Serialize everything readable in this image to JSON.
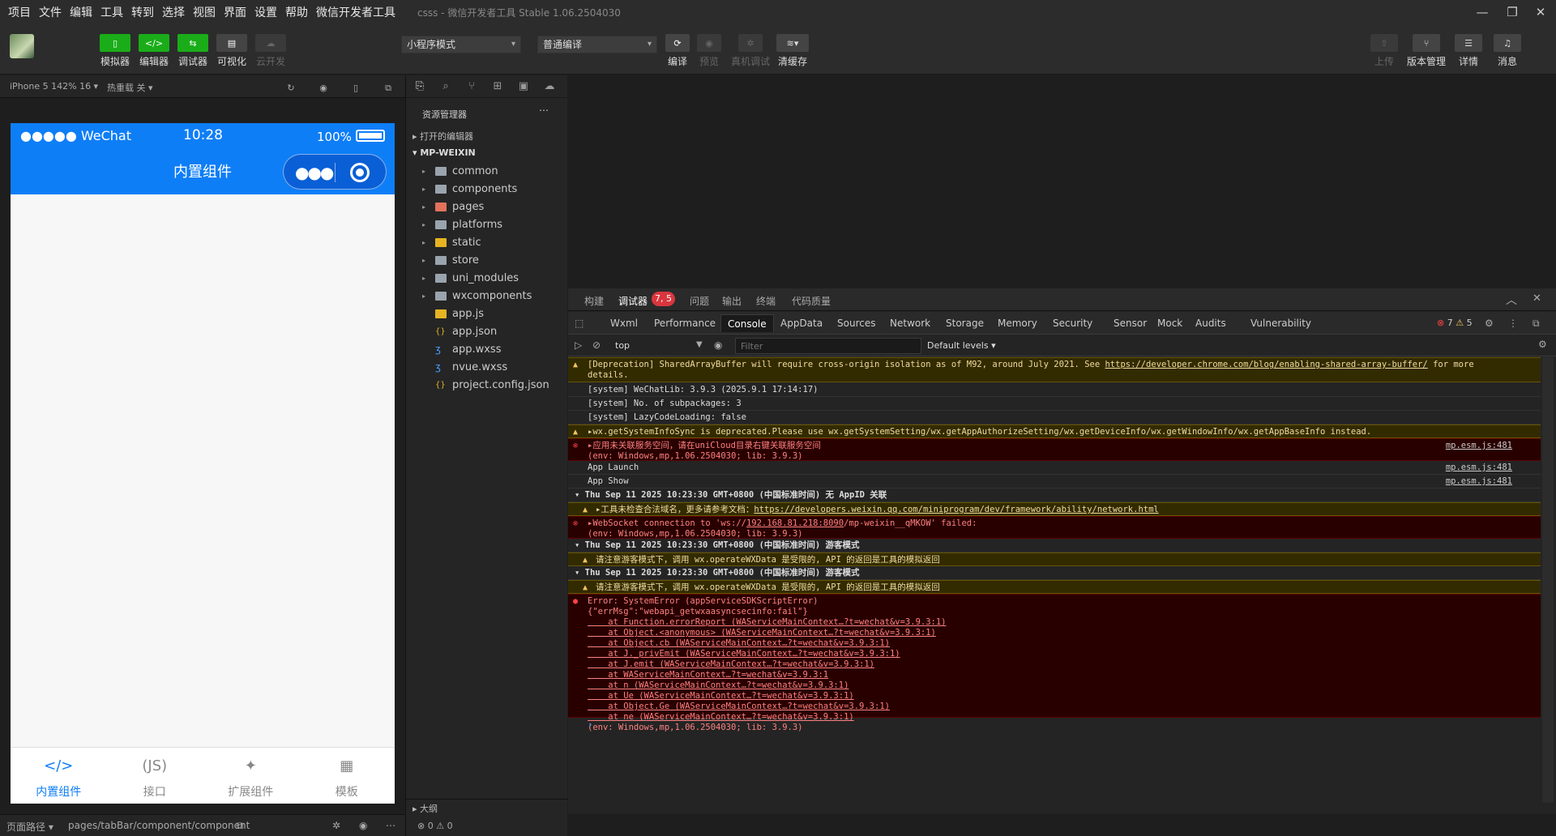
{
  "menubar": {
    "items": [
      "项目",
      "文件",
      "编辑",
      "工具",
      "转到",
      "选择",
      "视图",
      "界面",
      "设置",
      "帮助",
      "微信开发者工具"
    ],
    "window_title": "csss - 微信开发者工具 Stable 1.06.2504030"
  },
  "toolbar": {
    "simulator": "模拟器",
    "editor": "编辑器",
    "debugger": "调试器",
    "visual": "可视化",
    "cloud": "云开发",
    "mode_select": "小程序模式",
    "compile_select": "普通编译",
    "compile": "编译",
    "preview": "预览",
    "real_debug": "真机调试",
    "clear_cache": "清缓存",
    "upload": "上传",
    "version": "版本管理",
    "details": "详情",
    "messages": "消息"
  },
  "simulator": {
    "device": "iPhone 5 142% 16 ▾",
    "hot_reload": "热重载 关 ▾",
    "status_carrier": "●●●●● WeChat",
    "status_time": "10:28",
    "status_battery": "100%",
    "nav_title": "内置组件",
    "tabs": [
      {
        "icon": "</>",
        "label": "内置组件"
      },
      {
        "icon": "(JS)",
        "label": "接口"
      },
      {
        "icon": "✦",
        "label": "扩展组件"
      },
      {
        "icon": "▦",
        "label": "模板"
      }
    ],
    "page_path_label": "页面路径 ▾",
    "page_path": "pages/tabBar/component/component"
  },
  "explorer": {
    "title": "资源管理器",
    "open_editors": "打开的编辑器",
    "project": "MP-WEIXIN",
    "folders": [
      "common",
      "components",
      "pages",
      "platforms",
      "static",
      "store",
      "uni_modules",
      "wxcomponents"
    ],
    "files": [
      "app.js",
      "app.json",
      "app.wxss",
      "nvue.wxss",
      "project.config.json"
    ],
    "outline": "大纲",
    "counts": "⊗ 0 ⚠ 0"
  },
  "devtools": {
    "top_tabs": [
      "构建",
      "调试器",
      "问题",
      "输出",
      "终端",
      "代码质量"
    ],
    "badge": "7, 5",
    "panel_tabs": [
      "Wxml",
      "Performance",
      "Console",
      "AppData",
      "Sources",
      "Network",
      "Storage",
      "Memory",
      "Security",
      "Sensor",
      "Mock",
      "Audits",
      "Vulnerability"
    ],
    "err_count": "7",
    "warn_count": "5",
    "context": "top",
    "filter_placeholder": "Filter",
    "levels": "Default levels ▾"
  },
  "console": {
    "deprecation_1": "[Deprecation] SharedArrayBuffer will require cross-origin isolation as of M92, around July 2021. See ",
    "deprecation_link": "https://developer.chrome.com/blog/enabling-shared-array-buffer/",
    "deprecation_2": " for more",
    "deprecation_3": "details.",
    "sys1": "[system] WeChatLib: 3.9.3 (2025.9.1 17:14:17)",
    "sys2": "[system] No. of subpackages: 3",
    "sys3": "[system] LazyCodeLoading: false",
    "warn_sysinfo": "▸wx.getSystemInfoSync is deprecated.Please use wx.getSystemSetting/wx.getAppAuthorizeSetting/wx.getDeviceInfo/wx.getWindowInfo/wx.getAppBaseInfo instead.",
    "err_cloud_1": "▸应用未关联服务空间，请在uniCloud目录右键关联服务空间",
    "err_cloud_2": "(env: Windows,mp,1.06.2504030; lib: 3.9.3)",
    "src": "mp.esm.js:481",
    "app_launch": "App Launch",
    "app_show": "App Show",
    "group1": "▾ Thu Sep 11 2025 10:23:30 GMT+0800 (中国标准时间) 无 AppID 关联",
    "domain_warn": "▸工具未检查合法域名，更多请参考文档：",
    "domain_link": "https://developers.weixin.qq.com/miniprogram/dev/framework/ability/network.html",
    "ws_err_1": "▸WebSocket connection to 'ws://",
    "ws_err_host": "192.168.81.218:8090",
    "ws_err_2": "/mp-weixin__qMKOW' failed:",
    "ws_err_3": "(env: Windows,mp,1.06.2504030; lib: 3.9.3)",
    "group2": "▾ Thu Sep 11 2025 10:23:30 GMT+0800 (中国标准时间) 游客模式",
    "guest_warn": "请注意游客模式下，调用 wx.operateWXData 是受限的, API 的返回是工具的模拟返回",
    "group3": "▾ Thu Sep 11 2025 10:23:30 GMT+0800 (中国标准时间) 游客模式",
    "guest_warn2": "请注意游客模式下，调用 wx.operateWXData 是受限的, API 的返回是工具的模拟返回",
    "stack": [
      "Error: SystemError (appServiceSDKScriptError)",
      "{\"errMsg\":\"webapi_getwxaasyncsecinfo:fail\"}",
      "    at Function.errorReport (WAServiceMainContext…?t=wechat&v=3.9.3:1)",
      "    at Object.<anonymous> (WAServiceMainContext…?t=wechat&v=3.9.3:1)",
      "    at Object.cb (WAServiceMainContext…?t=wechat&v=3.9.3:1)",
      "    at J._privEmit (WAServiceMainContext…?t=wechat&v=3.9.3:1)",
      "    at J.emit (WAServiceMainContext…?t=wechat&v=3.9.3:1)",
      "    at WAServiceMainContext…?t=wechat&v=3.9.3:1",
      "    at n (WAServiceMainContext…?t=wechat&v=3.9.3:1)",
      "    at Ue (WAServiceMainContext…?t=wechat&v=3.9.3:1)",
      "    at Object.Ge (WAServiceMainContext…?t=wechat&v=3.9.3:1)",
      "    at ne (WAServiceMainContext…?t=wechat&v=3.9.3:1)",
      "(env: Windows,mp,1.06.2504030; lib: 3.9.3)"
    ],
    "prompt": "›"
  },
  "colors": {
    "accent": "#0e7ef7",
    "green": "#1aad19",
    "error": "#ff5555",
    "warning": "#f2c55c"
  }
}
